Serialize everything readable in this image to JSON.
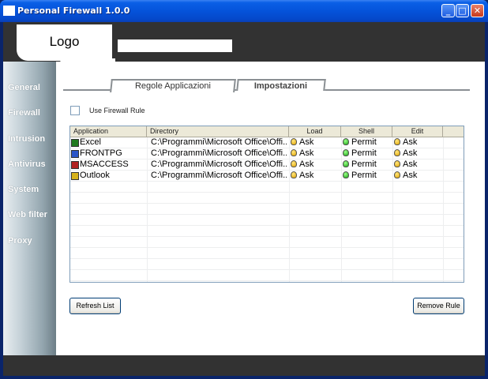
{
  "window": {
    "title": "Personal Firewall 1.0.0",
    "controls": {
      "minimize": "_",
      "maximize": "□",
      "close": "✕"
    }
  },
  "header": {
    "logo": "Logo"
  },
  "sidebar": {
    "items": [
      {
        "label": "General"
      },
      {
        "label": "Firewall"
      },
      {
        "label": "Intrusion"
      },
      {
        "label": "Antivirus"
      },
      {
        "label": "System"
      },
      {
        "label": "Web filter"
      },
      {
        "label": "Proxy"
      }
    ]
  },
  "tabs": [
    {
      "label": "Regole Applicazioni",
      "active": true
    },
    {
      "label": "Impostazioni",
      "active": false
    }
  ],
  "options": {
    "use_firewall_rule": {
      "label": "Use Firewall Rule",
      "checked": false
    }
  },
  "table": {
    "columns": [
      "Application",
      "Directory",
      "Load",
      "Shell",
      "Edit"
    ],
    "rows": [
      {
        "icon": "excel-icon",
        "icon_color": "#1f7a1f",
        "app": "Excel",
        "dir": "C:\\Programmi\\Microsoft Office\\Offi...",
        "load": "Ask",
        "shell": "Permit",
        "edit": "Ask"
      },
      {
        "icon": "frontpage-icon",
        "icon_color": "#2b55c8",
        "app": "FRONTPG",
        "dir": "C:\\Programmi\\Microsoft Office\\Offi...",
        "load": "Ask",
        "shell": "Permit",
        "edit": "Ask"
      },
      {
        "icon": "access-icon",
        "icon_color": "#b22222",
        "app": "MSACCESS",
        "dir": "C:\\Programmi\\Microsoft Office\\Offi...",
        "load": "Ask",
        "shell": "Permit",
        "edit": "Ask"
      },
      {
        "icon": "outlook-icon",
        "icon_color": "#d6b21a",
        "app": "Outlook",
        "dir": "C:\\Programmi\\Microsoft Office\\Offi...",
        "load": "Ask",
        "shell": "Permit",
        "edit": "Ask"
      }
    ]
  },
  "buttons": {
    "refresh": "Refresh List",
    "remove": "Remove Rule"
  },
  "colors": {
    "titlebar": "#0553da",
    "header": "#323232",
    "ask": "#e0a400",
    "permit": "#1aa312"
  }
}
